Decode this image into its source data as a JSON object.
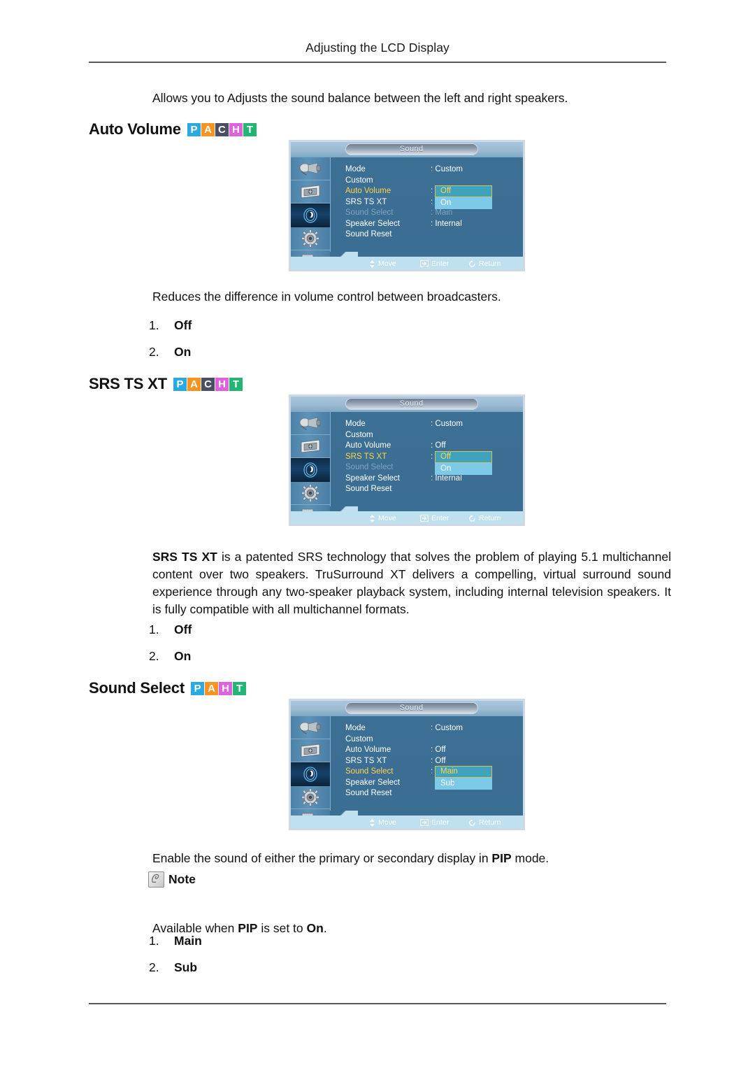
{
  "header": {
    "running_title": "Adjusting the LCD Display"
  },
  "intro": {
    "text": "Allows you to Adjusts the sound balance between the left and right speakers."
  },
  "badge_colors": {
    "P": "#29abe2",
    "A": "#f7931e",
    "C": "#4a4f63",
    "H": "#e060e0",
    "T": "#22b573"
  },
  "sections": [
    {
      "heading": "Auto Volume",
      "badges": [
        "P",
        "A",
        "C",
        "H",
        "T"
      ],
      "description": "Reduces the difference in volume control between broadcasters.",
      "options": [
        {
          "num": "1.",
          "label": "Off"
        },
        {
          "num": "2.",
          "label": "On"
        }
      ]
    },
    {
      "heading": "SRS TS XT",
      "badges": [
        "P",
        "A",
        "C",
        "H",
        "T"
      ],
      "description_bold": "SRS TS XT",
      "description": " is a patented SRS technology that solves the problem of playing 5.1 multichannel content over two speakers. TruSurround XT delivers a compelling, virtual surround sound experience through any two-speaker playback system, including internal television speakers. It is fully compatible with all multichannel formats.",
      "options": [
        {
          "num": "1.",
          "label": "Off"
        },
        {
          "num": "2.",
          "label": "On"
        }
      ]
    },
    {
      "heading": "Sound Select",
      "badges": [
        "P",
        "A",
        "H",
        "T"
      ],
      "description": "Enable the sound of either the primary or secondary display in PIP mode.",
      "note_label": "Note",
      "note_text": "Available when PIP is set to On.",
      "options": [
        {
          "num": "1.",
          "label": "Main"
        },
        {
          "num": "2.",
          "label": "Sub"
        }
      ]
    }
  ],
  "osd": {
    "title": "Sound",
    "rail_icons": [
      "picture-input-icon",
      "display-image-icon",
      "sound-speaker-icon",
      "setup-gear-icon",
      "multi-control-icon"
    ],
    "footer": [
      {
        "icon": "updown-arrow-icon",
        "label": "Move"
      },
      {
        "icon": "enter-icon",
        "label": "Enter"
      },
      {
        "icon": "return-icon",
        "label": "Return"
      }
    ],
    "screens": [
      {
        "id": "auto-volume",
        "rows": [
          {
            "name": "Mode",
            "value": ": Custom",
            "state": "normal"
          },
          {
            "name": "Custom",
            "value": "",
            "state": "normal"
          },
          {
            "name": "Auto Volume",
            "value": ":",
            "state": "selected"
          },
          {
            "name": "SRS TS XT",
            "value": ":",
            "state": "normal"
          },
          {
            "name": "Sound Select",
            "value": ": Main",
            "state": "dim"
          },
          {
            "name": "Speaker Select",
            "value": ": Internal",
            "state": "normal"
          },
          {
            "name": "Sound Reset",
            "value": "",
            "state": "normal"
          }
        ],
        "popup": {
          "top_row": 2,
          "focused": "Off",
          "plain": "On"
        }
      },
      {
        "id": "srs-ts-xt",
        "rows": [
          {
            "name": "Mode",
            "value": ": Custom",
            "state": "normal"
          },
          {
            "name": "Custom",
            "value": "",
            "state": "normal"
          },
          {
            "name": "Auto Volume",
            "value": ": Off",
            "state": "normal"
          },
          {
            "name": "SRS TS XT",
            "value": ":",
            "state": "selected"
          },
          {
            "name": "Sound Select",
            "value": "",
            "state": "dim"
          },
          {
            "name": "Speaker Select",
            "value": ": Internal",
            "state": "normal"
          },
          {
            "name": "Sound Reset",
            "value": "",
            "state": "normal"
          }
        ],
        "popup": {
          "top_row": 3,
          "focused": "Off",
          "plain": "On"
        }
      },
      {
        "id": "sound-select",
        "rows": [
          {
            "name": "Mode",
            "value": ": Custom",
            "state": "normal"
          },
          {
            "name": "Custom",
            "value": "",
            "state": "normal"
          },
          {
            "name": "Auto Volume",
            "value": ": Off",
            "state": "normal"
          },
          {
            "name": "SRS TS XT",
            "value": ": Off",
            "state": "normal"
          },
          {
            "name": "Sound Select",
            "value": ":",
            "state": "selected"
          },
          {
            "name": "Speaker Select",
            "value": "",
            "state": "normal"
          },
          {
            "name": "Sound Reset",
            "value": "",
            "state": "normal"
          }
        ],
        "popup": {
          "top_row": 4,
          "focused": "Main",
          "plain": "Sub"
        }
      }
    ]
  }
}
